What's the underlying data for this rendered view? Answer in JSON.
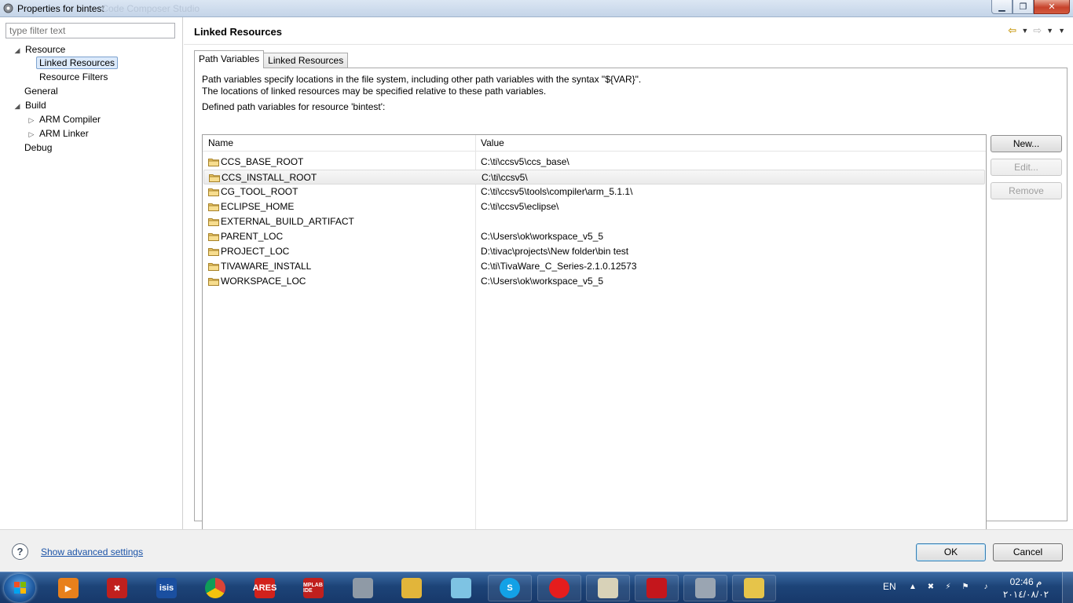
{
  "window": {
    "title": "Properties for bintest",
    "ghost_title": "- Code Composer Studio",
    "minimize_glyph": "▁",
    "maximize_glyph": "❐",
    "close_glyph": "✕"
  },
  "sidebar": {
    "filter_placeholder": "type filter text",
    "items": [
      {
        "label": "Resource",
        "expander": "◢"
      },
      {
        "label": "Linked Resources",
        "expander": ""
      },
      {
        "label": "Resource Filters",
        "expander": ""
      },
      {
        "label": "General",
        "expander": ""
      },
      {
        "label": "Build",
        "expander": "◢"
      },
      {
        "label": "ARM Compiler",
        "expander": "▷"
      },
      {
        "label": "ARM Linker",
        "expander": "▷"
      },
      {
        "label": "Debug",
        "expander": ""
      }
    ],
    "selected": "Linked Resources"
  },
  "page": {
    "title": "Linked Resources",
    "nav": {
      "back": "⇦",
      "forward": "⇨",
      "dropdown": "▼"
    },
    "tabs": [
      {
        "label": "Path Variables",
        "active": true
      },
      {
        "label": "Linked Resources",
        "active": false
      }
    ],
    "description_line1": "Path variables specify locations in the file system, including other path variables with the syntax \"${VAR}\".",
    "description_line2": "The locations of linked resources may be specified relative to these path variables.",
    "defined_label": "Defined path variables for resource 'bintest':",
    "table": {
      "columns": [
        "Name",
        "Value"
      ],
      "rows": [
        {
          "name": "CCS_BASE_ROOT",
          "value": "C:\\ti\\ccsv5\\ccs_base\\"
        },
        {
          "name": "CCS_INSTALL_ROOT",
          "value": "C:\\ti\\ccsv5\\"
        },
        {
          "name": "CG_TOOL_ROOT",
          "value": "C:\\ti\\ccsv5\\tools\\compiler\\arm_5.1.1\\"
        },
        {
          "name": "ECLIPSE_HOME",
          "value": "C:\\ti\\ccsv5\\eclipse\\"
        },
        {
          "name": "EXTERNAL_BUILD_ARTIFACT",
          "value": ""
        },
        {
          "name": "PARENT_LOC",
          "value": "C:\\Users\\ok\\workspace_v5_5"
        },
        {
          "name": "PROJECT_LOC",
          "value": "D:\\tivac\\projects\\New folder\\bin test"
        },
        {
          "name": "TIVAWARE_INSTALL",
          "value": "C:\\ti\\TivaWare_C_Series-2.1.0.12573"
        },
        {
          "name": "WORKSPACE_LOC",
          "value": "C:\\Users\\ok\\workspace_v5_5"
        }
      ],
      "hovered_row": "CCS_INSTALL_ROOT"
    },
    "buttons": {
      "new": "New...",
      "edit": "Edit...",
      "remove": "Remove"
    }
  },
  "footer": {
    "help": "?",
    "advanced_link": "Show advanced settings",
    "ok": "OK",
    "cancel": "Cancel"
  },
  "taskbar": {
    "apps": [
      {
        "name": "media-player-icon",
        "label": "▶",
        "color": "#e8801c"
      },
      {
        "name": "proteus-icon",
        "label": "✖",
        "color": "#c0201e"
      },
      {
        "name": "isis-icon",
        "label": "isis",
        "color": "#1a4fa0"
      },
      {
        "name": "chrome-icon",
        "label": "",
        "color": "#2f8f3a"
      },
      {
        "name": "ares-icon",
        "label": "ARES",
        "color": "#d2221c"
      },
      {
        "name": "mplab-icon",
        "label": "MPLAB IDE",
        "color": "#c0201e"
      },
      {
        "name": "cube-icon",
        "label": "",
        "color": "#8f9aa6"
      },
      {
        "name": "network-folder-icon",
        "label": "",
        "color": "#e2b53a"
      },
      {
        "name": "notepad-icon",
        "label": "",
        "color": "#7ec3e3"
      },
      {
        "name": "skype-icon",
        "label": "S",
        "color": "#13a1e6"
      },
      {
        "name": "vodafone-icon",
        "label": "",
        "color": "#e51d1d"
      },
      {
        "name": "settings-app-icon",
        "label": "",
        "color": "#d8d2b8"
      },
      {
        "name": "acrobat-icon",
        "label": "",
        "color": "#c4161c"
      },
      {
        "name": "ccs-cube-icon",
        "label": "",
        "color": "#9aa5b2"
      },
      {
        "name": "explorer-icon",
        "label": "",
        "color": "#e6c44a"
      }
    ],
    "language": "EN",
    "time": "02:46 م",
    "date": "٢٠١٤/٠٨/٠٢"
  }
}
